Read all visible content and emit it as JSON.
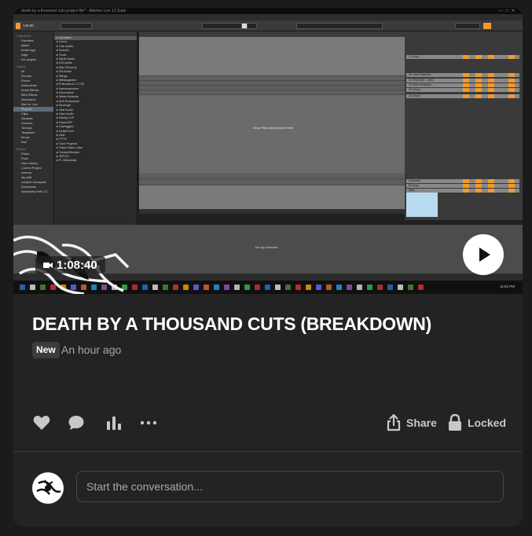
{
  "video": {
    "duration": "1:08:40",
    "daw": {
      "window_title": "death by a thousand cuts project file* - Ableton Live 12 Suite",
      "menu": [
        "File",
        "Edit",
        "Create",
        "Playback",
        "View",
        "Navigate",
        "Options",
        "Help"
      ],
      "tempo": "140.00",
      "drop_text": "Drop Files and Devices Here",
      "no_clip": "No clip selected.",
      "clock": "11:02 PM",
      "browser_sections": [
        {
          "header": "Collections",
          "items": [
            "Favorites",
            "album",
            "break logic",
            "edge",
            "live plugins"
          ]
        },
        {
          "header": "Library",
          "items": [
            "All",
            "Sounds",
            "Drums",
            "Instruments",
            "Audio Effects",
            "MIDI Effects",
            "Modulators",
            "Max for Live",
            "Plug-Ins",
            "Clips",
            "Samples",
            "Grooves",
            "Tunings",
            "Templates",
            "the go",
            "else"
          ]
        },
        {
          "header": "Places",
          "items": [
            "Packs",
            "Push",
            "User Library",
            "Current Project",
            "zzrecon",
            "My stuff",
            "complex transpose",
            "Downloads",
            "downloads-Part-2-3"
          ]
        }
      ],
      "files": [
        "Cymatics",
        "Lunox",
        "Tuar Audio",
        "Nusorin",
        "Truck",
        "Synth Audio",
        "KJ3 Audio",
        "Slim Records",
        "FM Audio",
        "Wings",
        "Wildargarden",
        "Potencial & CJ CSI",
        "Nanomachines",
        "Rezonance",
        "Wave Alchemy",
        "W.A Production",
        "Revenge",
        "Vital Audio",
        "Gain Audio",
        "Infinity LDP",
        "DrumDEP",
        "Unplugged",
        "UnderFloor",
        "orbit",
        "TYTH",
        "Tune Projects",
        "Tokyo Dawn Labs",
        "TroubleShooter",
        "TBTCH",
        "FL Ministudio"
      ],
      "mixer_tracks": [
        "1 Group",
        "20 Laser Machine",
        "21 REASIDE - MKD",
        "22 Killer transform",
        "23 Group",
        "24 Group",
        "A Reverb",
        "B Delay",
        "Main"
      ]
    }
  },
  "post": {
    "title": "DEATH BY A THOUSAND CUTS (BREAKDOWN)",
    "badge": "New",
    "time": "An hour ago"
  },
  "actions": {
    "like_icon": "heart-icon",
    "comment_icon": "comment-icon",
    "stats_icon": "bar-chart-icon",
    "more_icon": "more-icon",
    "share_label": "Share",
    "locked_label": "Locked"
  },
  "comment": {
    "placeholder": "Start the conversation..."
  }
}
